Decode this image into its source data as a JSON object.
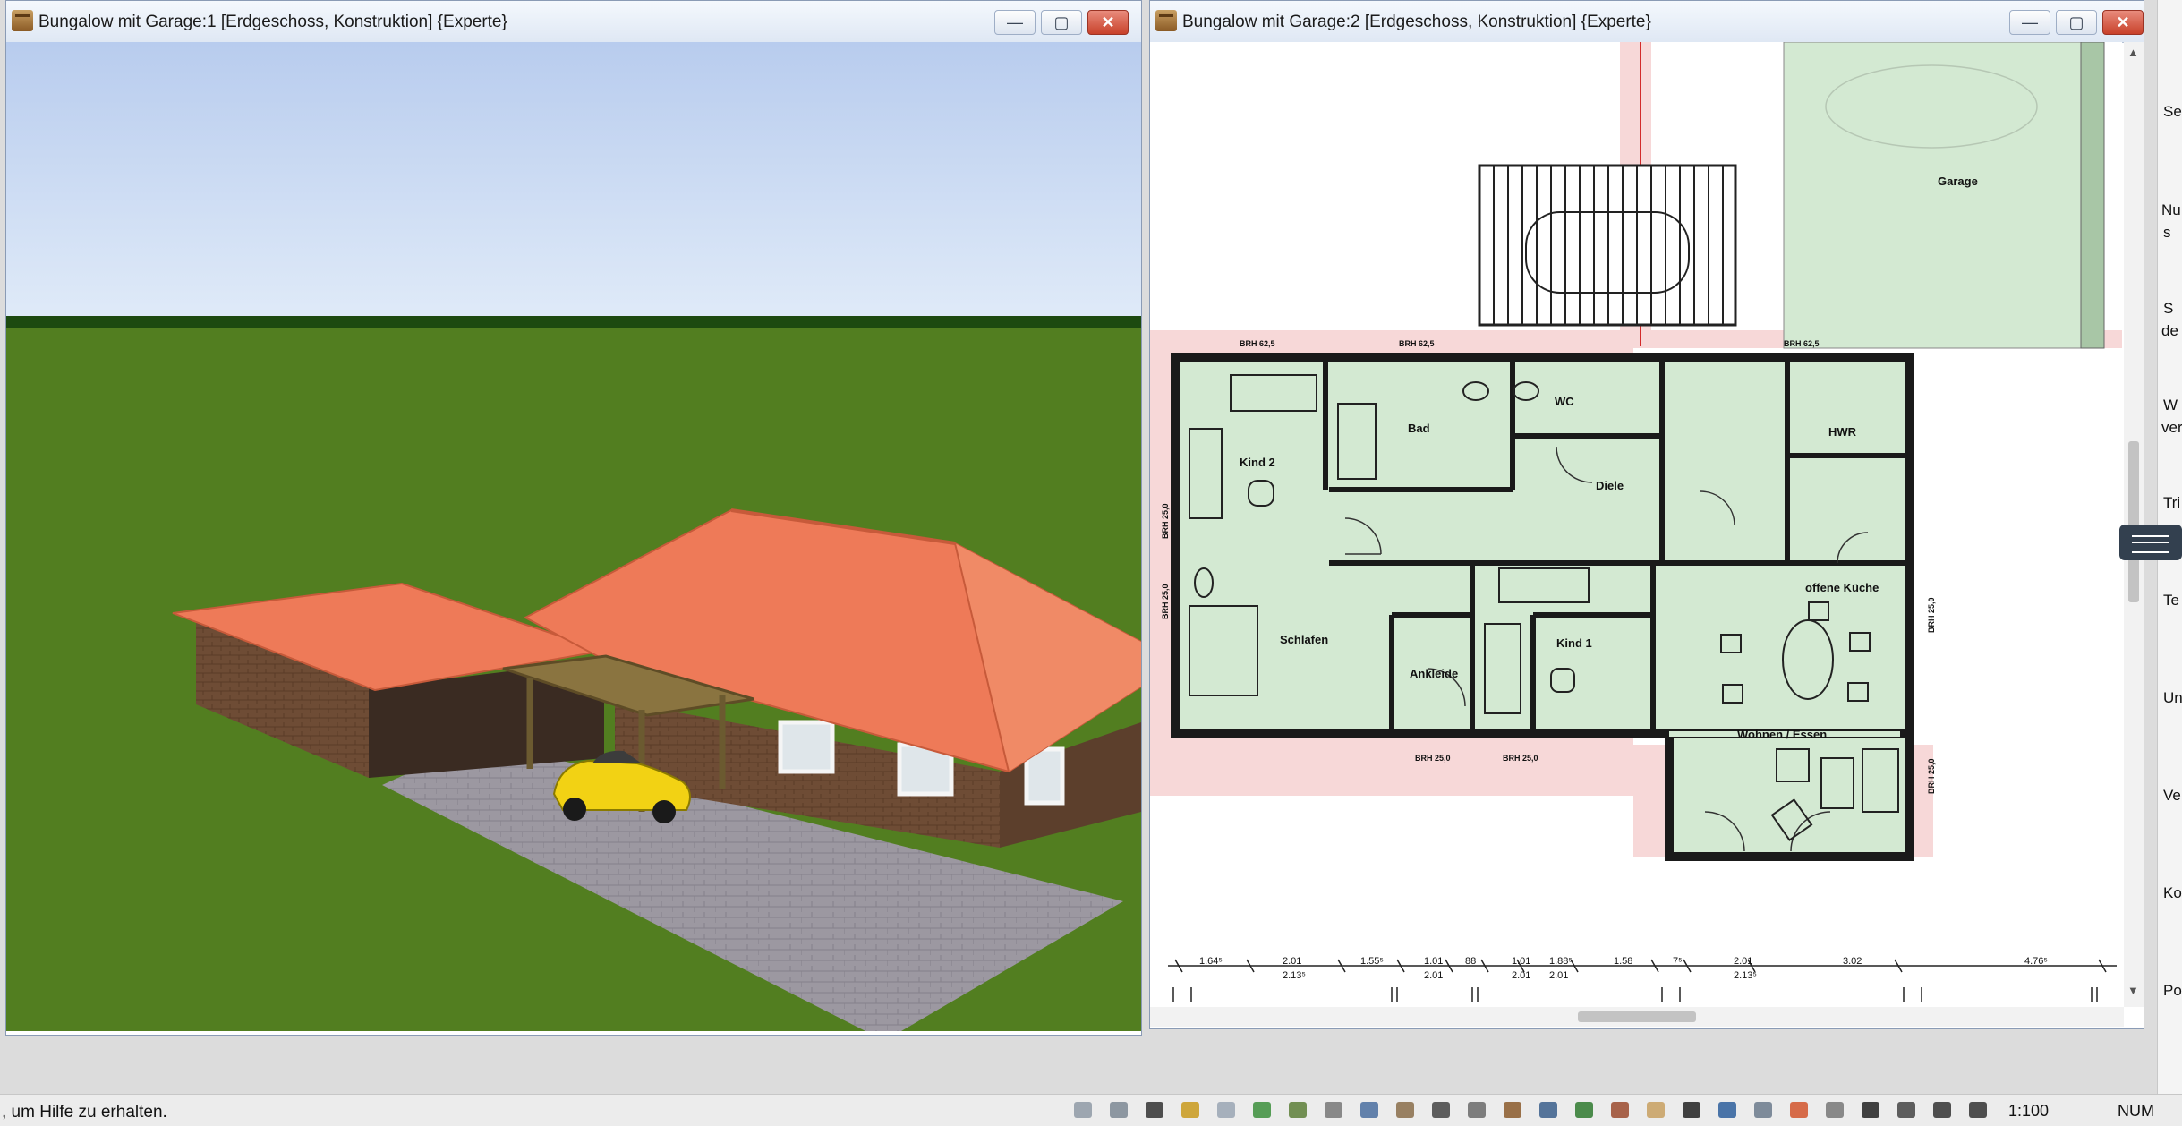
{
  "window1": {
    "title": "Bungalow mit Garage:1 [Erdgeschoss, Konstruktion] {Experte}"
  },
  "window2": {
    "title": "Bungalow mit Garage:2 [Erdgeschoss, Konstruktion] {Experte}"
  },
  "window_buttons": {
    "minimize": "—",
    "maximize": "▢",
    "close": "✕"
  },
  "plan": {
    "rooms": [
      "Garage",
      "WC",
      "Bad",
      "HWR",
      "Kind 2",
      "Diele",
      "offene Küche",
      "Schlafen",
      "Ankleide",
      "Kind 1",
      "Wohnen / Essen"
    ],
    "brh_top": [
      "BRH 62,5",
      "BRH 62,5",
      "BRH 62,5"
    ],
    "brh_bottom": [
      "BRH 25,0",
      "BRH 25,0"
    ],
    "brh_side": [
      "BRH 25,0",
      "BRH 25,0",
      "BRH 25,0",
      "BRH 25,0"
    ],
    "dimensions_top": [
      "1.64⁵",
      "2.01",
      "1.55⁵",
      "1.01",
      "88",
      "1.01",
      "1.88⁵",
      "1.58",
      "7⁵",
      "2.01",
      "3.02",
      "4.76⁵"
    ],
    "dimensions_bottom": [
      "2.13⁵",
      "2.01",
      "2.01",
      "2.01",
      "2.13⁵"
    ]
  },
  "right_panel": {
    "labels": [
      "Se",
      "Nu",
      "s",
      "S",
      "de",
      "W",
      "ver",
      "Tri",
      "Te",
      "Un",
      "Ve",
      "Ko",
      "Po"
    ]
  },
  "status": {
    "help_text": ", um Hilfe zu erhalten.",
    "scale": "1:100",
    "num": "NUM"
  },
  "toolbar_icons": [
    "fill-area-icon",
    "line-icon",
    "grid-icon",
    "pencil-icon",
    "roof-icon",
    "terrain-icon",
    "texture-icon",
    "hatch-icon",
    "window-icon",
    "stairs-icon",
    "footprints-icon",
    "chair-icon",
    "sofa-icon",
    "office-chair-icon",
    "tree-icon",
    "figure-icon",
    "hand-icon",
    "anchor-icon",
    "blue-shape-icon",
    "box-icon",
    "3d-icon",
    "pattern-icon",
    "spelling-icon",
    "measure-icon",
    "north-arrow-icon",
    "camera-icon"
  ]
}
